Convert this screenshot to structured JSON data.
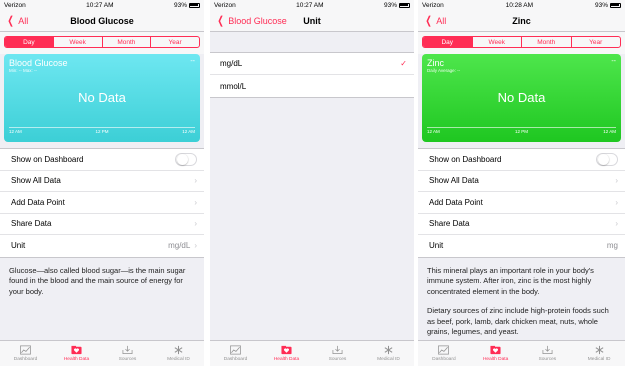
{
  "screen1": {
    "status": {
      "carrier": "Verizon",
      "time": "10:27 AM",
      "battery": "93%"
    },
    "nav": {
      "back": "All",
      "title": "Blood Glucose"
    },
    "segments": [
      "Day",
      "Week",
      "Month",
      "Year"
    ],
    "chart": {
      "title": "Blood Glucose",
      "subtitle": "Min: --  Max: --",
      "dash": "--",
      "no_data": "No Data",
      "axis": [
        "12 AM",
        "12 PM",
        "12 AM"
      ]
    },
    "rows": {
      "dashboard": "Show on Dashboard",
      "all_data": "Show All Data",
      "add_point": "Add Data Point",
      "share": "Share Data",
      "unit": "Unit",
      "unit_value": "mg/dL"
    },
    "description": "Glucose—also called blood sugar—is the main sugar found in the blood and the main source of energy for your body."
  },
  "screen2": {
    "status": {
      "carrier": "Verizon",
      "time": "10:27 AM",
      "battery": "93%"
    },
    "nav": {
      "back": "Blood Glucose",
      "title": "Unit"
    },
    "units": [
      "mg/dL",
      "mmol/L"
    ]
  },
  "screen3": {
    "status": {
      "carrier": "Verizon",
      "time": "10:28 AM",
      "battery": "93%"
    },
    "nav": {
      "back": "All",
      "title": "Zinc"
    },
    "segments": [
      "Day",
      "Week",
      "Month",
      "Year"
    ],
    "chart": {
      "title": "Zinc",
      "subtitle": "Daily Average: --",
      "dash": "--",
      "no_data": "No Data",
      "axis": [
        "12 AM",
        "12 PM",
        "12 AM"
      ]
    },
    "rows": {
      "dashboard": "Show on Dashboard",
      "all_data": "Show All Data",
      "add_point": "Add Data Point",
      "share": "Share Data",
      "unit": "Unit",
      "unit_value": "mg"
    },
    "description": [
      "This mineral plays an important role in your body's immune system. After iron, zinc is the most highly concentrated element in the body.",
      "Dietary sources of zinc include high-protein foods such as beef, pork, lamb, dark chicken meat, nuts, whole grains, legumes, and yeast."
    ]
  },
  "tabs": [
    "Dashboard",
    "Health Data",
    "Sources",
    "Medical ID"
  ],
  "colors": {
    "accent": "#ff2d55",
    "glucose_chart": "#4fd8de",
    "zinc_chart": "#2fd431"
  }
}
